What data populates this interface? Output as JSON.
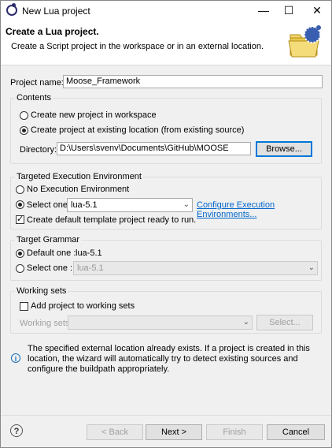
{
  "window": {
    "title": "New Lua project",
    "minimize": "—",
    "maximize": "☐",
    "close": "✕"
  },
  "header": {
    "title": "Create a Lua project.",
    "subtitle": "Create a Script project in the workspace or in an external location."
  },
  "project_name": {
    "label": "Project name:",
    "value": "Moose_Framework"
  },
  "contents": {
    "title": "Contents",
    "option_new": "Create new project in workspace",
    "option_existing": "Create project at existing location (from existing source)",
    "directory_label": "Directory:",
    "directory_value": "D:\\Users\\svenv\\Documents\\GitHub\\MOOSE",
    "browse": "Browse..."
  },
  "environment": {
    "title": "Targeted Execution Environment",
    "option_none": "No Execution Environment",
    "option_select": "Select one:",
    "selected": "lua-5.1",
    "configure_link": "Configure Execution Environments...",
    "template_check": "Create default template project ready to run."
  },
  "grammar": {
    "title": "Target Grammar",
    "option_default": "Default one :",
    "default_value": "lua-5.1",
    "option_select": "Select one :",
    "select_value": "lua-5.1"
  },
  "working_sets": {
    "title": "Working sets",
    "add_check": "Add project to working sets",
    "label": "Working sets:",
    "value": "",
    "select_button": "Select..."
  },
  "info": {
    "message": "The specified external location already exists. If a project is created in this location, the wizard will automatically try to detect existing sources and configure the buildpath appropriately."
  },
  "buttons": {
    "back": "< Back",
    "next": "Next >",
    "finish": "Finish",
    "cancel": "Cancel"
  }
}
